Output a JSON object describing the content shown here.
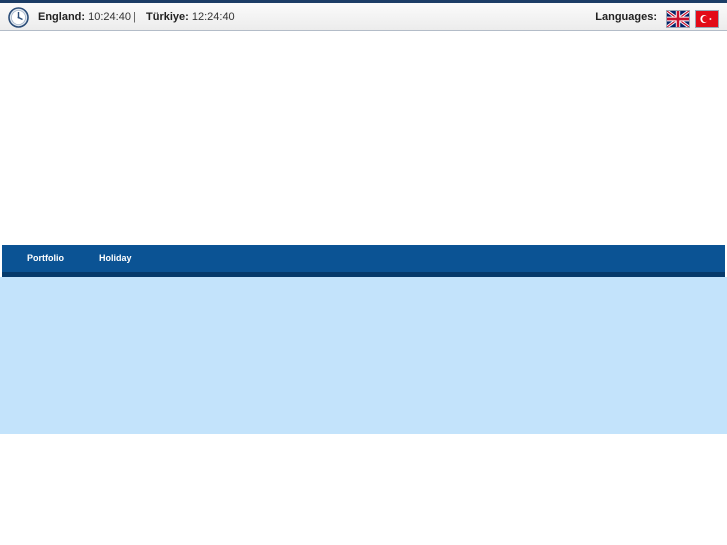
{
  "topbar": {
    "clocks": [
      {
        "label": "England:",
        "time": "10:24:40"
      },
      {
        "label": "Türkiye:",
        "time": "12:24:40"
      }
    ],
    "separator": "|",
    "languages_label": "Languages:",
    "flags": [
      {
        "icon": "uk-flag-icon"
      },
      {
        "icon": "turkey-flag-icon"
      }
    ]
  },
  "nav": {
    "items": [
      {
        "label": "Portfolio"
      },
      {
        "label": "Holiday"
      }
    ]
  },
  "colors": {
    "topbar_border": "#1c3d66",
    "nav_background": "#0b5394",
    "nav_bottom": "#063a6b",
    "content_panel": "#c3e3fb"
  }
}
